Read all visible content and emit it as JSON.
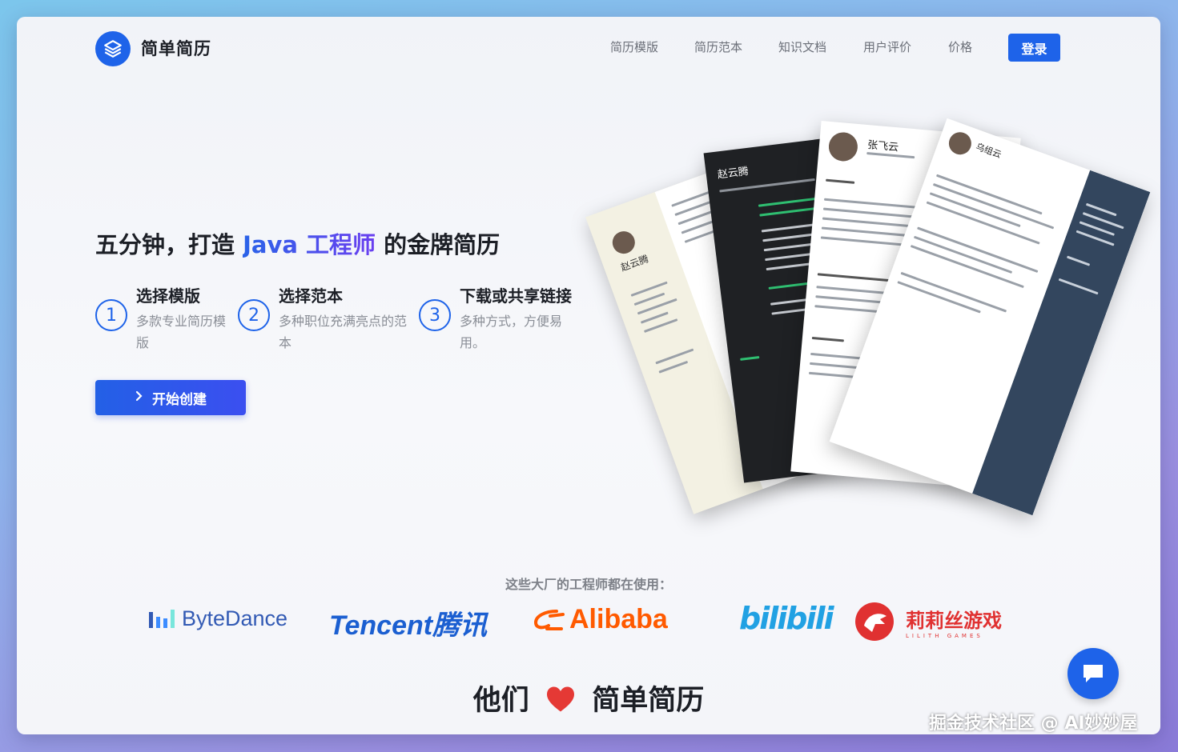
{
  "header": {
    "brand": "简单简历",
    "nav": [
      "简历模版",
      "简历范本",
      "知识文档",
      "用户评价",
      "价格"
    ],
    "login": "登录"
  },
  "hero": {
    "headline_pre": "五分钟，打造",
    "headline_highlight": "Java 工程师",
    "headline_post": "的金牌简历",
    "steps": [
      {
        "num": "1",
        "title": "选择模版",
        "desc": "多款专业简历模版"
      },
      {
        "num": "2",
        "title": "选择范本",
        "desc": "多种职位充满亮点的范本"
      },
      {
        "num": "3",
        "title": "下载或共享链接",
        "desc": "多种方式，方便易用。"
      }
    ],
    "start_button": "开始创建"
  },
  "resume_cards": {
    "card1_name": "赵云腾",
    "card2_name": "赵云腾",
    "card3_name": "张飞云",
    "card4_name": "乌组云"
  },
  "companies": {
    "label": "这些大厂的工程师都在使用：",
    "logos": [
      "ByteDance",
      "Tencent腾讯",
      "Alibaba",
      "bilibili",
      "莉莉丝游戏"
    ],
    "lilith_sub": "LILITH GAMES"
  },
  "footer": {
    "title_left": "他们",
    "title_right": "简单简历"
  },
  "watermark": "掘金技术社区 @ AI妙妙屋",
  "icons": [
    "layers-icon",
    "chevron-right-icon",
    "heart-icon",
    "chat-icon"
  ],
  "colors": {
    "primary": "#1e63e9",
    "bytedance": "#3c8cff",
    "tencent": "#1b5fd1",
    "alibaba": "#ff5a00",
    "bilibili": "#21a1e3",
    "lilith": "#e03131"
  }
}
